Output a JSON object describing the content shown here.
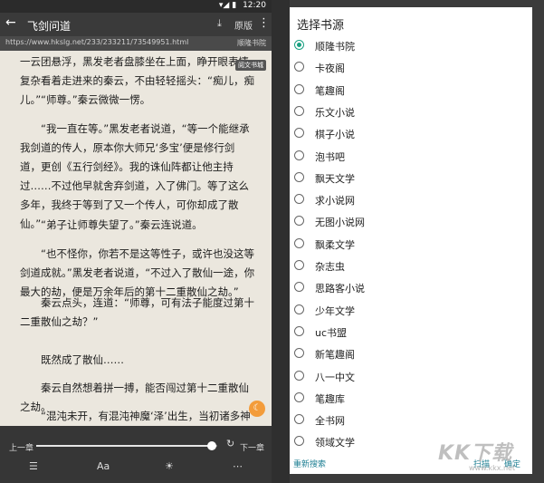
{
  "statusbar": {
    "time": "12:20",
    "signal_icon": "signal-icon",
    "battery_icon": "battery-icon"
  },
  "toolbar": {
    "title": "飞剑问道",
    "download_icon": "download-icon",
    "source_label": "原版",
    "more_icon": "more-vert-icon"
  },
  "urlbar": {
    "url": "https://www.hkslg.net/233/233211/73549951.html",
    "site": "顺隆书院"
  },
  "reader": {
    "paragraphs": [
      "一云团悬浮，黑发老者盘膝坐在上面，睁开眼表情复杂看着走进来的秦云，不由轻轻摇头：“痴儿，痴儿。”",
      "“师尊。”秦云微微一愣。",
      "“我一直在等。”黑发老者说道，“等一个能继承我剑道的传人，原本你大师兄‘多宝’便是修行剑道，更创《五行剑经》。我的诛仙阵都让他主持过……不过他早就舍弃剑道，入了佛门。等了这么多年，我终于等到了又一个传人，可你却成了散仙。”",
      "“弟子让师尊失望了。”秦云连说道。",
      "“也不怪你，你若不是这等性子，或许也没这等剑道成就。”黑发老者说道，“不过入了散仙一途，你最大的劫，便是万余年后的第十二重散仙之劫。”",
      "秦云点头，连道：“师尊，可有法子能度过第十二重散仙之劫？”",
      "既然成了散仙……",
      "秦云自然想着拼一搏，能否闯过第十二重散仙之劫。",
      "“混沌未开，有混沌神魔‘泽’出生，当初诸多神魔各自"
    ],
    "read_tag": "阅文书城",
    "fab_icon": "night-mode-icon"
  },
  "bottom": {
    "prev_chapter": "上一章",
    "next_chapter": "下一章",
    "progress": 0.97,
    "refresh_icon": "refresh-icon",
    "menu_icons": [
      "list-icon",
      "font-size-icon",
      "brightness-icon",
      "more-horiz-icon"
    ],
    "font_label": "Aa"
  },
  "dialog": {
    "title": "选择书源",
    "selected_index": 0,
    "options": [
      "顺隆书院",
      "卡夜阁",
      "笔趣阁",
      "乐文小说",
      "棋子小说",
      "泡书吧",
      "飘天文学",
      "求小说网",
      "无图小说网",
      "飘柔文学",
      "杂志虫",
      "思路客小说",
      "少年文学",
      "uc书盟",
      "新笔趣阁",
      "八一中文",
      "笔趣库",
      "全书网",
      "领域文学"
    ],
    "actions": {
      "research": "重新搜索",
      "scan": "扫描",
      "confirm": "确定"
    }
  },
  "watermark": {
    "text": "KK下载",
    "sub": "www.kkx.net"
  },
  "colors": {
    "accent": "#19a081",
    "action": "#1e7f93",
    "fab": "#f39c3b",
    "paper": "#ebe7de"
  }
}
